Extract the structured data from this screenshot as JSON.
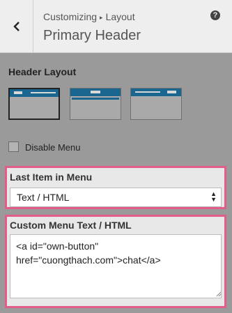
{
  "header": {
    "breadcrumb_root": "Customizing",
    "breadcrumb_arrow": "▸",
    "breadcrumb_section": "Layout",
    "title": "Primary Header",
    "help": "?"
  },
  "header_layout": {
    "label": "Header Layout",
    "options": [
      "layout-left",
      "layout-center",
      "layout-right"
    ],
    "selected": "layout-left"
  },
  "disable_menu": {
    "label": "Disable Menu",
    "checked": false
  },
  "last_item": {
    "label": "Last Item in Menu",
    "value": "Text / HTML"
  },
  "custom_menu_text": {
    "label": "Custom Menu Text / HTML",
    "value": "<a id=\"own-button\"\nhref=\"cuongthach.com\">chat</a>"
  },
  "colors": {
    "highlight_border": "#e25d8a",
    "layout_bar": "#1a6690",
    "sidebar_bg": "#9a9a9a"
  }
}
